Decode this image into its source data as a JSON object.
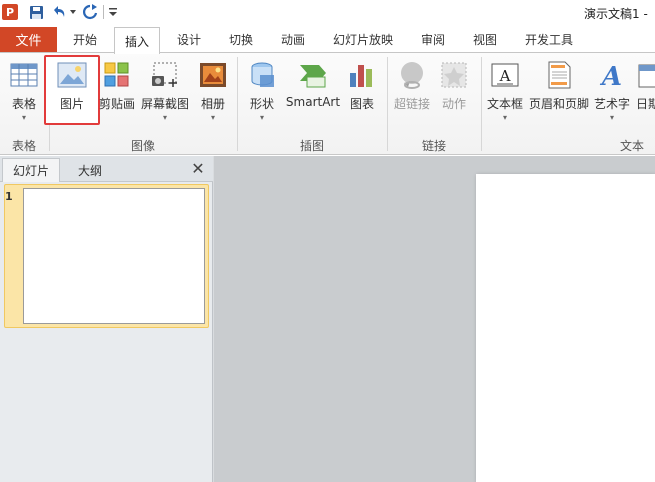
{
  "app_logo": "P",
  "window_title": "演示文稿1 -",
  "tabs": {
    "file": "文件",
    "items": [
      "开始",
      "插入",
      "设计",
      "切换",
      "动画",
      "幻灯片放映",
      "审阅",
      "视图",
      "开发工具"
    ],
    "active": "插入"
  },
  "ribbon": {
    "table": "表格",
    "picture": "图片",
    "clipart": "剪贴画",
    "screenshot": "屏幕截图",
    "album": "相册",
    "shapes": "形状",
    "smartart": "SmartArt",
    "chart": "图表",
    "hyperlink": "超链接",
    "action": "动作",
    "textbox": "文本框",
    "header_footer": "页眉和页脚",
    "wordart": "艺术字",
    "datetime": "日期",
    "caret": "▾"
  },
  "groups": {
    "tables": "表格",
    "images": "图像",
    "illustrations": "插图",
    "links": "链接",
    "text": "文本"
  },
  "left_pane": {
    "tab_slides": "幻灯片",
    "tab_outline": "大纲",
    "close": "✕",
    "slide_number": "1"
  },
  "colors": {
    "file_tab": "#d24726",
    "highlight_border": "#e23b3b",
    "selected_thumb": "#fbe5a7"
  }
}
